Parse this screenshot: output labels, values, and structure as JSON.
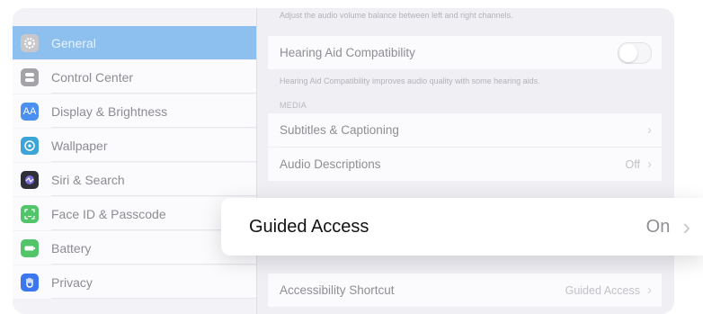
{
  "colors": {
    "selected_bg": "#8ec0ef",
    "general_icon": "#c7c7cc",
    "control_center_icon": "#a3a3a8",
    "display_icon": "#4b8ff0",
    "wallpaper_icon": "#3aa5d6",
    "siri_icon": "#2f2f3a",
    "faceid_icon": "#52c46a",
    "battery_icon": "#52c46a",
    "privacy_icon": "#3b78f0"
  },
  "sidebar": {
    "items": [
      {
        "label": "General",
        "icon": "gear-icon",
        "selected": true
      },
      {
        "label": "Control Center",
        "icon": "toggles-icon"
      },
      {
        "label": "Display & Brightness",
        "icon": "text-size-icon"
      },
      {
        "label": "Wallpaper",
        "icon": "flower-icon"
      },
      {
        "label": "Siri & Search",
        "icon": "siri-icon"
      },
      {
        "label": "Face ID & Passcode",
        "icon": "face-id-icon"
      },
      {
        "label": "Battery",
        "icon": "battery-icon"
      },
      {
        "label": "Privacy",
        "icon": "hand-icon"
      }
    ]
  },
  "main": {
    "balance_note": "Adjust the audio volume balance between left and right channels.",
    "hearing_aid": {
      "label": "Hearing Aid Compatibility",
      "on": false
    },
    "hearing_note": "Hearing Aid Compatibility improves audio quality with some hearing aids.",
    "media_header": "MEDIA",
    "subtitles": {
      "label": "Subtitles & Captioning"
    },
    "audio_descriptions": {
      "label": "Audio Descriptions",
      "value": "Off"
    },
    "guided_access": {
      "label": "Guided Access",
      "value": "On"
    },
    "accessibility_shortcut": {
      "label": "Accessibility Shortcut",
      "value": "Guided Access"
    }
  }
}
